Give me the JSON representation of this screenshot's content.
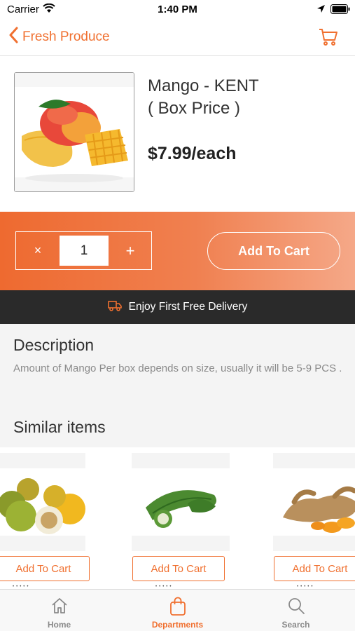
{
  "status_bar": {
    "carrier": "Carrier",
    "time": "1:40 PM"
  },
  "nav": {
    "back_label": "Fresh Produce",
    "cart_icon": "cart-icon",
    "back_icon": "chevron-left-icon"
  },
  "product": {
    "name_line1": "Mango - KENT",
    "name_line2": "( Box Price )",
    "price": "$7.99/each",
    "image": "mango-image"
  },
  "quantity": {
    "minus_symbol": "×",
    "value": "1",
    "plus_symbol": "+"
  },
  "actions": {
    "add_to_cart": "Add To Cart"
  },
  "delivery": {
    "text": "Enjoy First Free Delivery",
    "icon": "delivery-truck-icon"
  },
  "description": {
    "title": "Description",
    "text": "Amount of Mango Per box depends on size, usually it will be 5-9 PCS ."
  },
  "similar": {
    "title": "Similar items",
    "items": [
      {
        "image": "passion-fruit-image",
        "button": "Add To Cart"
      },
      {
        "image": "bitter-melon-image",
        "button": "Add To Cart"
      },
      {
        "image": "turmeric-root-image",
        "button": "Add To Cart"
      }
    ]
  },
  "tabs": [
    {
      "label": "Home",
      "icon": "home-icon",
      "active": false
    },
    {
      "label": "Departments",
      "icon": "shopping-bag-icon",
      "active": true
    },
    {
      "label": "Search",
      "icon": "search-icon",
      "active": false
    }
  ],
  "colors": {
    "accent": "#f07030",
    "banner": "#2a2a2a",
    "text_muted": "#8a8a8a"
  }
}
